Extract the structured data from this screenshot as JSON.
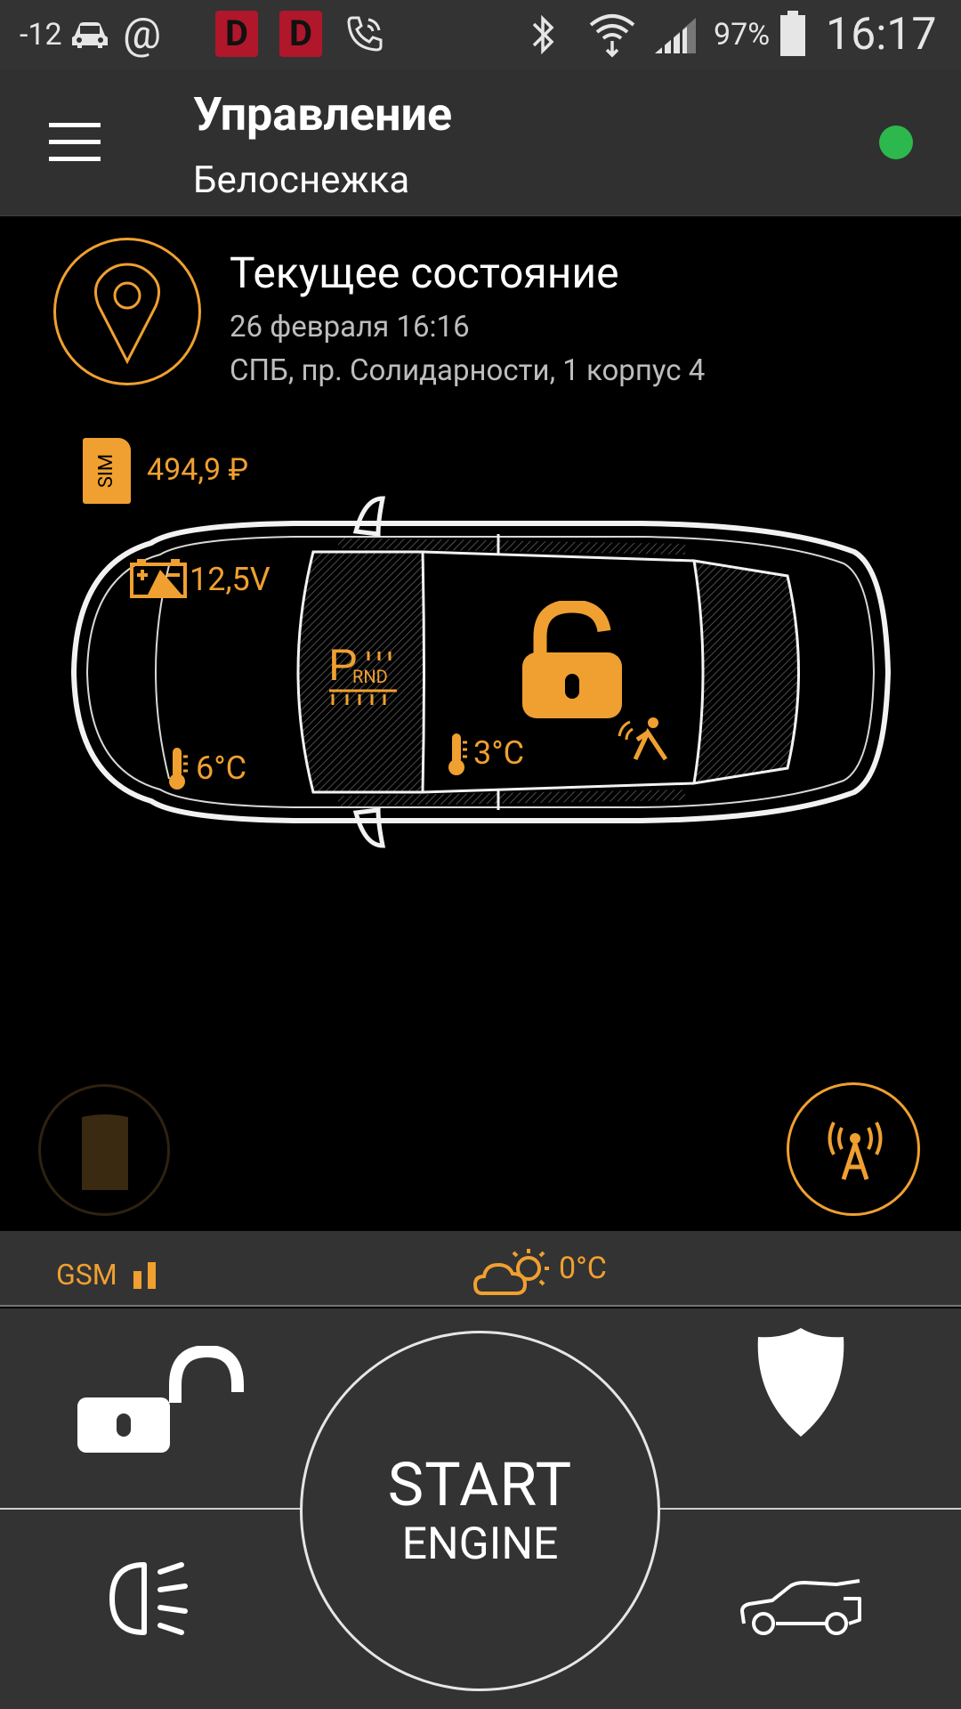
{
  "status_bar": {
    "temperature": "-12",
    "badge_1": "D",
    "badge_2": "D",
    "battery_percent": "97%",
    "clock": "16:17"
  },
  "app_bar": {
    "title": "Управление",
    "subtitle": "Белоснежка",
    "connection_color": "#2db84e"
  },
  "state": {
    "title": "Текущее состояние",
    "date": "26 февраля 16:16",
    "address": "СПБ, пр. Солидарности, 1 корпус 4"
  },
  "car": {
    "sim_label": "SIM",
    "sim_balance": "494,9 ₽",
    "battery_voltage": "12,5V",
    "gear_park": "P",
    "gear_rnd": "RND",
    "engine_temp": "6°C",
    "cabin_temp": "3°C"
  },
  "info_strip": {
    "gsm_label": "GSM",
    "outside_temp": "0°C"
  },
  "controls": {
    "start_line1": "START",
    "start_line2": "ENGINE"
  },
  "colors": {
    "accent": "#f0a030",
    "panel": "#333333",
    "background": "#000000"
  }
}
